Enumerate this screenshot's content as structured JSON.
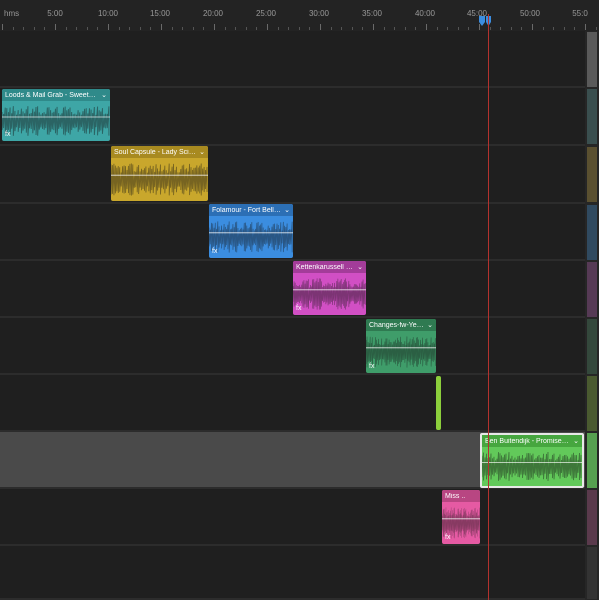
{
  "ruler": {
    "units_label": "hms",
    "ticks": [
      "5:00",
      "10:00",
      "15:00",
      "20:00",
      "25:00",
      "30:00",
      "35:00",
      "40:00",
      "45:00",
      "50:00",
      "55:0"
    ]
  },
  "colors": {
    "teal": "#3ea6a6",
    "yellow": "#c9a72c",
    "blue": "#3b8de0",
    "magenta": "#d14fc4",
    "green": "#3f9d6a",
    "lime": "#8ccf3c",
    "bright_green": "#62c95a",
    "pink": "#e55aa3",
    "playhead": "#b3322e"
  },
  "clips": [
    {
      "name": "Loods & Mail Grab - Sweetness -",
      "color": "teal"
    },
    {
      "name": "Soul Capsule - Lady Science ..",
      "color": "yellow"
    },
    {
      "name": "Folamour - Fort Bellelle ..",
      "color": "blue"
    },
    {
      "name": "Kettenkarussell - M..",
      "color": "magenta"
    },
    {
      "name": "Changes-fw-YeFtg..",
      "color": "green"
    },
    {
      "name": "",
      "color": "lime"
    },
    {
      "name": "Ben Buitendijk - Promised Land..",
      "color": "bright_green"
    },
    {
      "name": "Miss ..",
      "color": "pink"
    }
  ],
  "fx_label": "fx"
}
